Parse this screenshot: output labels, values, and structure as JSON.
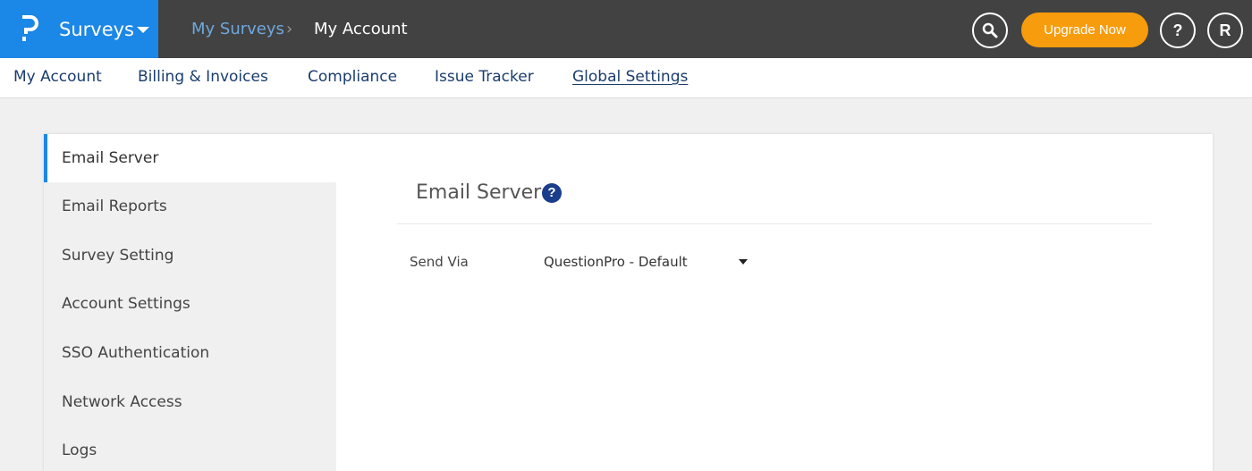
{
  "header": {
    "brand_name": "Surveys",
    "breadcrumbs": [
      "My Surveys",
      "My Account"
    ],
    "upgrade_label": "Upgrade Now",
    "help_label": "?",
    "user_initial": "R"
  },
  "nav": {
    "tabs": [
      {
        "label": "My Account"
      },
      {
        "label": "Billing & Invoices"
      },
      {
        "label": "Compliance"
      },
      {
        "label": "Issue Tracker"
      },
      {
        "label": "Global Settings",
        "active": true
      }
    ]
  },
  "sidebar": {
    "items": [
      {
        "label": "Email Server",
        "active": true
      },
      {
        "label": "Email Reports"
      },
      {
        "label": "Survey Setting"
      },
      {
        "label": "Account Settings"
      },
      {
        "label": "SSO Authentication"
      },
      {
        "label": "Network Access"
      },
      {
        "label": "Logs"
      }
    ]
  },
  "main": {
    "title": "Email Server",
    "title_help": "?",
    "send_via_label": "Send Via",
    "send_via_value": "QuestionPro - Default"
  },
  "colors": {
    "brand_blue": "#1b87e6",
    "topbar": "#424242",
    "upgrade_orange": "#f79c0d",
    "nav_text": "#1a3d6e"
  }
}
